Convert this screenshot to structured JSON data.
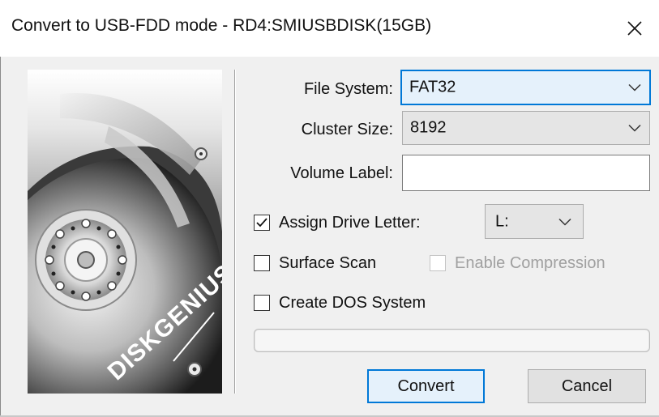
{
  "window": {
    "title": "Convert to USB-FDD mode - RD4:SMIUSBDISK(15GB)",
    "close_icon": "close-icon",
    "brand_text": "DISKGENIUS"
  },
  "form": {
    "file_system": {
      "label": "File System:",
      "value": "FAT32"
    },
    "cluster_size": {
      "label": "Cluster Size:",
      "value": "8192"
    },
    "volume_label": {
      "label": "Volume Label:",
      "value": ""
    },
    "assign_drive_letter": {
      "label": "Assign Drive Letter:",
      "checked": true,
      "value": "L:"
    },
    "surface_scan": {
      "label": "Surface Scan",
      "checked": false
    },
    "enable_compression": {
      "label": "Enable Compression",
      "checked": false,
      "disabled": true
    },
    "create_dos_system": {
      "label": "Create DOS System",
      "checked": false
    },
    "progress": 0
  },
  "buttons": {
    "convert": "Convert",
    "cancel": "Cancel"
  },
  "colors": {
    "accent": "#0078d7",
    "dialog_bg": "#f0f0f0"
  }
}
